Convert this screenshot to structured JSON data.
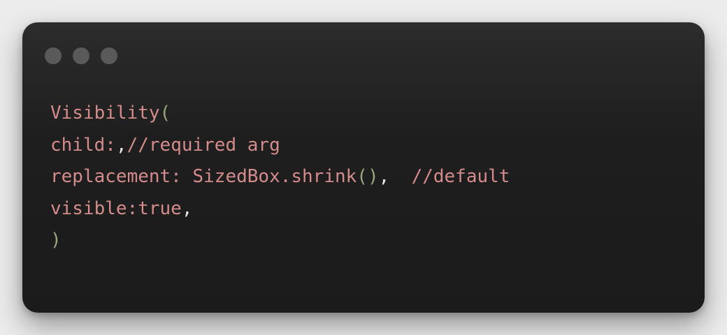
{
  "window": {
    "controls": [
      "close",
      "minimize",
      "maximize"
    ],
    "dot_color": "#5a5a5a"
  },
  "colors": {
    "identifier": "#d48b8b",
    "paren": "#9aa77f",
    "punctuation": "#e6e6e6",
    "background": "#1b1b1b"
  },
  "code": {
    "lines": [
      {
        "l1_ident": "Visibility",
        "l1_paren": "("
      },
      {
        "l2_ident": "child:",
        "l2_comma": ",",
        "l2_comment": "//required arg"
      },
      {
        "l3_ident": "replacement: SizedBox.shrink",
        "l3_paren": "()",
        "l3_comma": ",",
        "l3_comment": "  //default"
      },
      {
        "l4_ident": "visible:true",
        "l4_comma": ","
      },
      {
        "l5_paren": ")"
      }
    ]
  }
}
